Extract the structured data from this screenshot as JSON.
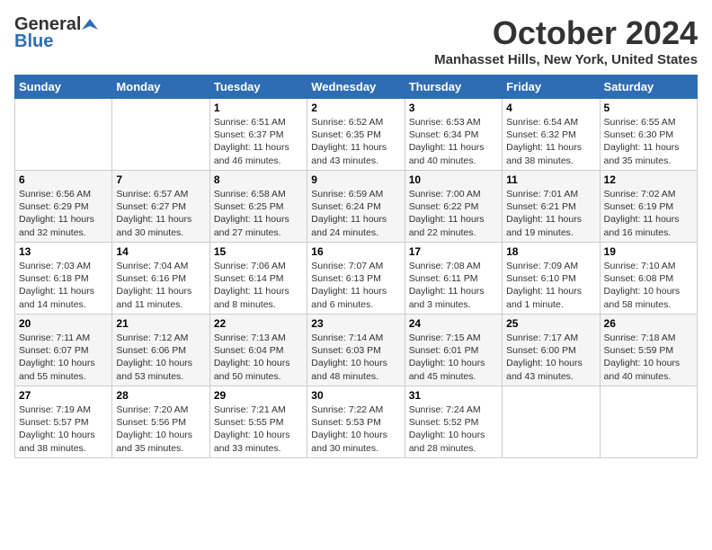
{
  "logo": {
    "general": "General",
    "blue": "Blue"
  },
  "title": {
    "month": "October 2024",
    "location": "Manhasset Hills, New York, United States"
  },
  "days_of_week": [
    "Sunday",
    "Monday",
    "Tuesday",
    "Wednesday",
    "Thursday",
    "Friday",
    "Saturday"
  ],
  "weeks": [
    [
      {
        "day": "",
        "content": ""
      },
      {
        "day": "",
        "content": ""
      },
      {
        "day": "1",
        "content": "Sunrise: 6:51 AM\nSunset: 6:37 PM\nDaylight: 11 hours and 46 minutes."
      },
      {
        "day": "2",
        "content": "Sunrise: 6:52 AM\nSunset: 6:35 PM\nDaylight: 11 hours and 43 minutes."
      },
      {
        "day": "3",
        "content": "Sunrise: 6:53 AM\nSunset: 6:34 PM\nDaylight: 11 hours and 40 minutes."
      },
      {
        "day": "4",
        "content": "Sunrise: 6:54 AM\nSunset: 6:32 PM\nDaylight: 11 hours and 38 minutes."
      },
      {
        "day": "5",
        "content": "Sunrise: 6:55 AM\nSunset: 6:30 PM\nDaylight: 11 hours and 35 minutes."
      }
    ],
    [
      {
        "day": "6",
        "content": "Sunrise: 6:56 AM\nSunset: 6:29 PM\nDaylight: 11 hours and 32 minutes."
      },
      {
        "day": "7",
        "content": "Sunrise: 6:57 AM\nSunset: 6:27 PM\nDaylight: 11 hours and 30 minutes."
      },
      {
        "day": "8",
        "content": "Sunrise: 6:58 AM\nSunset: 6:25 PM\nDaylight: 11 hours and 27 minutes."
      },
      {
        "day": "9",
        "content": "Sunrise: 6:59 AM\nSunset: 6:24 PM\nDaylight: 11 hours and 24 minutes."
      },
      {
        "day": "10",
        "content": "Sunrise: 7:00 AM\nSunset: 6:22 PM\nDaylight: 11 hours and 22 minutes."
      },
      {
        "day": "11",
        "content": "Sunrise: 7:01 AM\nSunset: 6:21 PM\nDaylight: 11 hours and 19 minutes."
      },
      {
        "day": "12",
        "content": "Sunrise: 7:02 AM\nSunset: 6:19 PM\nDaylight: 11 hours and 16 minutes."
      }
    ],
    [
      {
        "day": "13",
        "content": "Sunrise: 7:03 AM\nSunset: 6:18 PM\nDaylight: 11 hours and 14 minutes."
      },
      {
        "day": "14",
        "content": "Sunrise: 7:04 AM\nSunset: 6:16 PM\nDaylight: 11 hours and 11 minutes."
      },
      {
        "day": "15",
        "content": "Sunrise: 7:06 AM\nSunset: 6:14 PM\nDaylight: 11 hours and 8 minutes."
      },
      {
        "day": "16",
        "content": "Sunrise: 7:07 AM\nSunset: 6:13 PM\nDaylight: 11 hours and 6 minutes."
      },
      {
        "day": "17",
        "content": "Sunrise: 7:08 AM\nSunset: 6:11 PM\nDaylight: 11 hours and 3 minutes."
      },
      {
        "day": "18",
        "content": "Sunrise: 7:09 AM\nSunset: 6:10 PM\nDaylight: 11 hours and 1 minute."
      },
      {
        "day": "19",
        "content": "Sunrise: 7:10 AM\nSunset: 6:08 PM\nDaylight: 10 hours and 58 minutes."
      }
    ],
    [
      {
        "day": "20",
        "content": "Sunrise: 7:11 AM\nSunset: 6:07 PM\nDaylight: 10 hours and 55 minutes."
      },
      {
        "day": "21",
        "content": "Sunrise: 7:12 AM\nSunset: 6:06 PM\nDaylight: 10 hours and 53 minutes."
      },
      {
        "day": "22",
        "content": "Sunrise: 7:13 AM\nSunset: 6:04 PM\nDaylight: 10 hours and 50 minutes."
      },
      {
        "day": "23",
        "content": "Sunrise: 7:14 AM\nSunset: 6:03 PM\nDaylight: 10 hours and 48 minutes."
      },
      {
        "day": "24",
        "content": "Sunrise: 7:15 AM\nSunset: 6:01 PM\nDaylight: 10 hours and 45 minutes."
      },
      {
        "day": "25",
        "content": "Sunrise: 7:17 AM\nSunset: 6:00 PM\nDaylight: 10 hours and 43 minutes."
      },
      {
        "day": "26",
        "content": "Sunrise: 7:18 AM\nSunset: 5:59 PM\nDaylight: 10 hours and 40 minutes."
      }
    ],
    [
      {
        "day": "27",
        "content": "Sunrise: 7:19 AM\nSunset: 5:57 PM\nDaylight: 10 hours and 38 minutes."
      },
      {
        "day": "28",
        "content": "Sunrise: 7:20 AM\nSunset: 5:56 PM\nDaylight: 10 hours and 35 minutes."
      },
      {
        "day": "29",
        "content": "Sunrise: 7:21 AM\nSunset: 5:55 PM\nDaylight: 10 hours and 33 minutes."
      },
      {
        "day": "30",
        "content": "Sunrise: 7:22 AM\nSunset: 5:53 PM\nDaylight: 10 hours and 30 minutes."
      },
      {
        "day": "31",
        "content": "Sunrise: 7:24 AM\nSunset: 5:52 PM\nDaylight: 10 hours and 28 minutes."
      },
      {
        "day": "",
        "content": ""
      },
      {
        "day": "",
        "content": ""
      }
    ]
  ]
}
